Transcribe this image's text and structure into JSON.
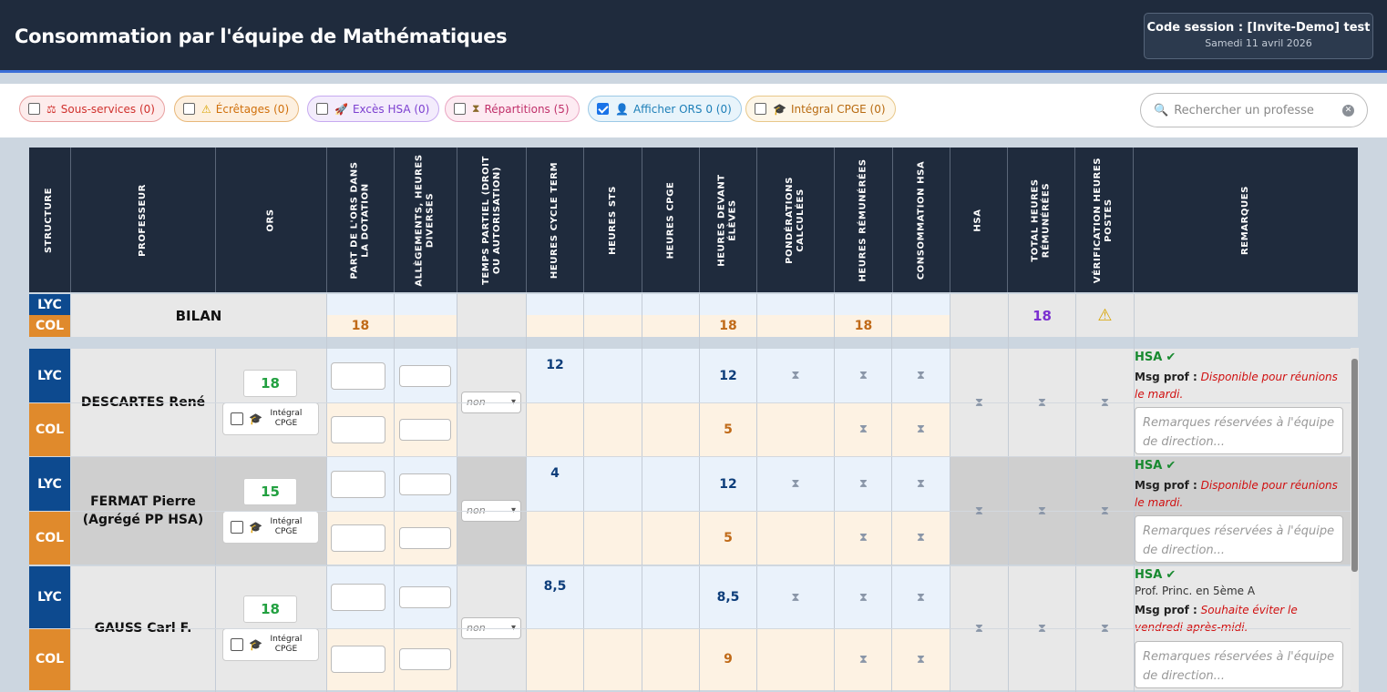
{
  "header": {
    "title": "Consommation par l'équipe de Mathématiques",
    "session_label": "Code session : [Invite-Demo] test",
    "session_date": "Samedi 11 avril 2026"
  },
  "filters": [
    {
      "label": "Sous-services (0)",
      "icon": "scale-icon",
      "checked": false,
      "color": "#d0312d"
    },
    {
      "label": "Écrêtages (0)",
      "icon": "warning-icon",
      "checked": false,
      "color": "#d0700c"
    },
    {
      "label": "Excès HSA (0)",
      "icon": "rocket-icon",
      "checked": false,
      "color": "#7c3fd0"
    },
    {
      "label": "Répartitions (5)",
      "icon": "hourglass-icon",
      "checked": false,
      "color": "#c0306a"
    },
    {
      "label": "Afficher ORS 0 (0)",
      "icon": "user-icon",
      "checked": true,
      "color": "#1d7fb8"
    },
    {
      "label": "Intégral CPGE (0)",
      "icon": "graduation-cap-icon",
      "checked": false,
      "color": "#b86a10"
    }
  ],
  "search": {
    "placeholder": "Rechercher un professeur..."
  },
  "columns": [
    "STRUCTURE",
    "PROFESSEUR",
    "ORS",
    "PART DE L'ORS DANS\nLA DOTATION",
    "ALLÈGEMENTS, HEURES\nDIVERSES",
    "TEMPS PARTIEL (DROIT\nOU AUTORISATION)",
    "HEURES CYCLE TERM",
    "HEURES STS",
    "HEURES CPGE",
    "HEURES DEVANT\nÉLÈVES",
    "PONDÉRATIONS\nCALCULÉES",
    "HEURES RÉMUNÉRÉES",
    "CONSOMMATION HSA",
    "HSA",
    "TOTAL HEURES\nRÉMUNÉRÉES",
    "VÉRIFICATION HEURES\nPOSTES",
    "REMARQUES"
  ],
  "bilan": {
    "label": "BILAN",
    "lyc_tag": "LYC",
    "col_tag": "COL",
    "col_part_ors": "18",
    "col_heures_devant": "18",
    "col_heures_remun": "18",
    "total_heures": "18",
    "verification_icon": "warning-icon"
  },
  "teachers": [
    {
      "name": "DESCARTES René",
      "ors": "18",
      "cpge_label": "Intégral CPGE",
      "temps_partiel": "non",
      "lyc": {
        "cycle_term": "12",
        "devant": "12"
      },
      "col": {
        "devant": "5"
      },
      "hsa_label": "HSA",
      "note": "",
      "msg_label": "Msg prof :",
      "msg": "Disponible pour réunions le mardi.",
      "remarks_placeholder": "Remarques réservées à l'équipe de direction..."
    },
    {
      "name": "FERMAT Pierre (Agrégé PP HSA)",
      "ors": "15",
      "cpge_label": "Intégral CPGE",
      "temps_partiel": "non",
      "lyc": {
        "cycle_term": "4",
        "devant": "12"
      },
      "col": {
        "devant": "5"
      },
      "hsa_label": "HSA",
      "note": "",
      "msg_label": "Msg prof :",
      "msg": "Disponible pour réunions le mardi.",
      "remarks_placeholder": "Remarques réservées à l'équipe de direction..."
    },
    {
      "name": "GAUSS Carl F.",
      "ors": "18",
      "cpge_label": "Intégral CPGE",
      "temps_partiel": "non",
      "lyc": {
        "cycle_term": "8,5",
        "devant": "8,5"
      },
      "col": {
        "devant": "9"
      },
      "hsa_label": "HSA",
      "note": "Prof. Princ. en 5ème A",
      "msg_label": "Msg prof :",
      "msg": "Souhaite éviter le vendredi après-midi.",
      "remarks_placeholder": "Remarques réservées à l'équipe de direction..."
    }
  ],
  "glyphs": {
    "hourglass": "⧗",
    "check": "✔",
    "warning": "⚠",
    "scale": "⚖",
    "rocket": "🚀",
    "user": "👤",
    "cap": "🎓",
    "search": "🔍",
    "clear": "✕",
    "chevron": "⌄"
  }
}
